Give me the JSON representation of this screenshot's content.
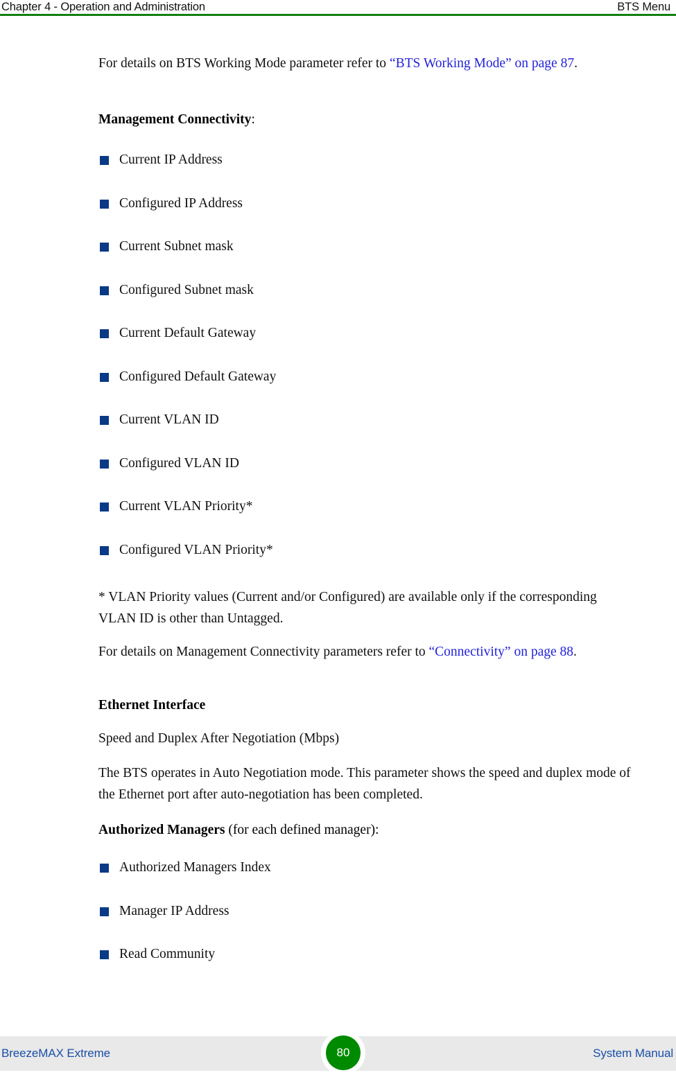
{
  "header": {
    "left": "Chapter 4 - Operation and Administration",
    "right": "BTS Menu",
    "rule_color": "#108010"
  },
  "colors": {
    "bullet": "#0a3a86",
    "link": "#2222dd",
    "footer_text": "#1a4fa8",
    "footer_band": "#e9e9e9",
    "badge": "#008a00",
    "body_text": "#101010"
  },
  "body": {
    "intro_paragraph": {
      "lead": "For details on BTS Working Mode parameter refer to ",
      "xref": "“BTS Working Mode” on page 87",
      "tail": "."
    },
    "management_connectivity_heading": "Management Connectivity",
    "management_connectivity_heading_colon": ":",
    "management_connectivity_items": [
      "Current IP Address",
      "Configured IP Address",
      "Current Subnet mask",
      "Configured Subnet mask",
      "Current Default Gateway",
      "Configured Default Gateway",
      "Current VLAN ID",
      "Configured VLAN ID",
      "Current VLAN Priority*",
      "Configured VLAN Priority*"
    ],
    "footnote": "* VLAN Priority values (Current and/or Configured) are available only if the corresponding VLAN ID is other than Untagged.",
    "connectivity_paragraph": {
      "lead": "For details on Management Connectivity parameters refer to ",
      "xref": "“Connectivity” on page 88",
      "tail": "."
    },
    "ethernet_interface_heading": "Ethernet Interface",
    "ethernet_speed_line": "Speed and Duplex After Negotiation (Mbps)",
    "ethernet_paragraph": "The BTS operates in Auto Negotiation mode. This parameter shows the speed and duplex mode of the Ethernet port after auto-negotiation has been completed.",
    "authorized_managers_heading": "Authorized Managers",
    "authorized_managers_heading_suffix": " (for each defined manager):",
    "authorized_managers_items": [
      "Authorized Managers Index",
      "Manager IP Address",
      "Read Community"
    ]
  },
  "footer": {
    "left": "BreezeMAX Extreme",
    "page_number": "80",
    "right": "System Manual"
  }
}
